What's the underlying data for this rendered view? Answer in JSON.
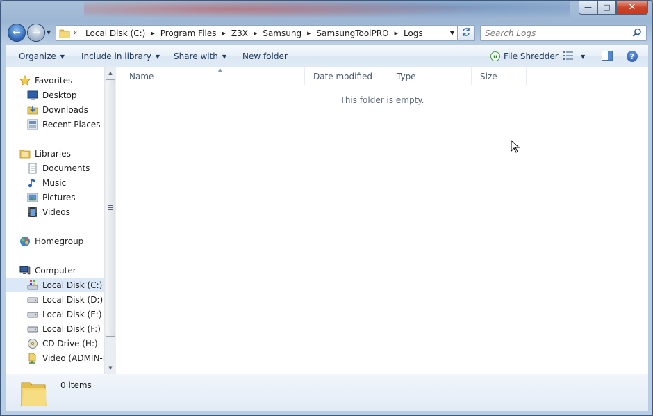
{
  "window": {
    "caption_minimize": "—",
    "caption_maximize": "□",
    "caption_close": "✕"
  },
  "nav": {
    "back_glyph": "←",
    "forward_glyph": "→",
    "recent_glyph": "▼"
  },
  "address": {
    "overflow_glyph": "«",
    "separator_glyph": "▶",
    "dropdown_glyph": "▼",
    "crumbs": [
      "Local Disk (C:)",
      "Program Files",
      "Z3X",
      "Samsung",
      "SamsungToolPRO",
      "Logs"
    ]
  },
  "search": {
    "placeholder": "Search Logs"
  },
  "toolbar": {
    "organize": "Organize",
    "include_in_library": "Include in library",
    "share_with": "Share with",
    "new_folder": "New folder",
    "file_shredder": "File Shredder",
    "help_glyph": "?",
    "dropdown_glyph": "▼"
  },
  "navpane": {
    "favorites": {
      "label": "Favorites",
      "items": [
        "Desktop",
        "Downloads",
        "Recent Places"
      ]
    },
    "libraries": {
      "label": "Libraries",
      "items": [
        "Documents",
        "Music",
        "Pictures",
        "Videos"
      ]
    },
    "homegroup": "Homegroup",
    "computer": {
      "label": "Computer",
      "items": [
        "Local Disk (C:)",
        "Local Disk (D:)",
        "Local Disk (E:)",
        "Local Disk (F:)",
        "CD Drive (H:)",
        "Video (ADMIN-P"
      ]
    },
    "selected": "Local Disk (C:)"
  },
  "columns": [
    "Name",
    "Date modified",
    "Type",
    "Size"
  ],
  "content": {
    "empty_message": "This folder is empty."
  },
  "details": {
    "item_count": "0 items"
  }
}
